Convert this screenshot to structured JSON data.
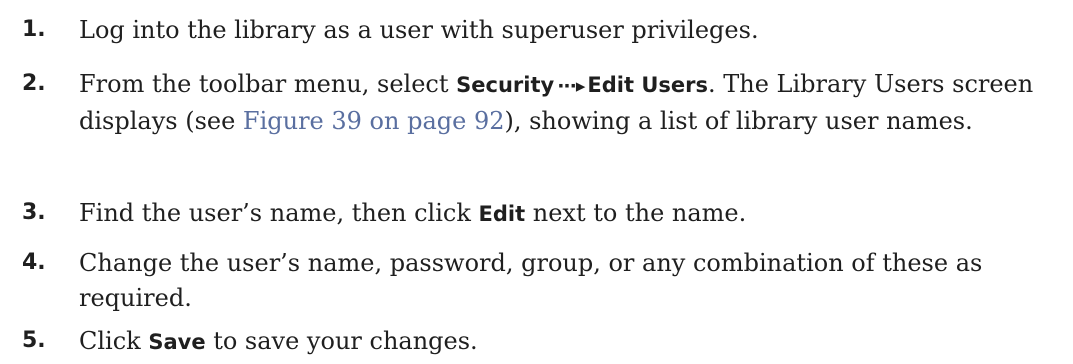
{
  "steps": [
    {
      "number": "1.",
      "text": "Log into the library as a user with superuser privileges."
    },
    {
      "number": "2.",
      "prefix": "From the toolbar menu, select ",
      "menu": "Security",
      "arrow": "···▸",
      "submenu": "Edit Users",
      "middle": ". The Library Users screen displays (see ",
      "link": "Figure 39 on page 92",
      "suffix": "), showing a list of library user names."
    },
    {
      "number": "3.",
      "prefix": "Find the user’s name, then click ",
      "button": "Edit",
      "suffix": " next to the name."
    },
    {
      "number": "4.",
      "text": "Change the user’s name, password, group, or any combination of these as required."
    },
    {
      "number": "5.",
      "prefix": "Click ",
      "button": "Save",
      "suffix": " to save your changes."
    }
  ]
}
